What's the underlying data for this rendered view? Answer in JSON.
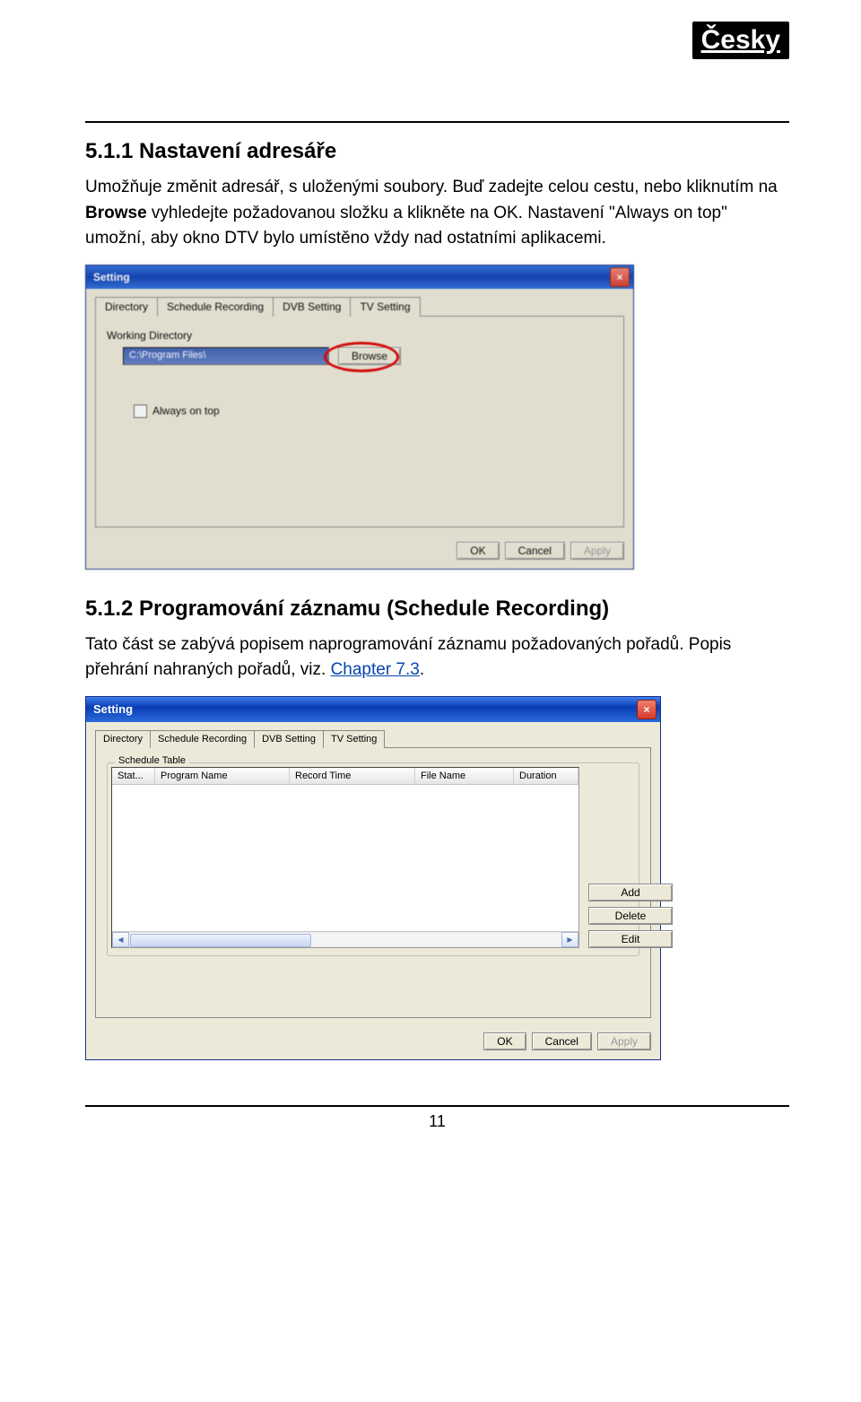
{
  "header": {
    "language_badge": "Česky"
  },
  "sections": {
    "s511": {
      "heading": "5.1.1 Nastavení adresáře",
      "p1_a": "Umožňuje změnit adresář, s uloženými soubory. Buď zadejte celou cestu, nebo kliknutím na ",
      "p1_bold": "Browse",
      "p1_b": " vyhledejte požadovanou složku a klikněte na OK. Nastavení \"Always on top\" umožní, aby okno DTV bylo umístěno vždy nad ostatními aplikacemi."
    },
    "s512": {
      "heading": "5.1.2 Programování záznamu (Schedule Recording)",
      "p1": "Tato část se zabývá popisem naprogramování záznamu požadovaných pořadů. Popis přehrání nahraných pořadů, viz. ",
      "link": "Chapter 7.3",
      "p1_end": "."
    }
  },
  "dialog1": {
    "title": "Setting",
    "tabs": [
      "Directory",
      "Schedule Recording",
      "DVB Setting",
      "TV Setting"
    ],
    "group_label": "Working Directory",
    "path_value": "C:\\Program Files\\",
    "browse": "Browse",
    "always_on_top": "Always on top",
    "ok": "OK",
    "cancel": "Cancel",
    "apply": "Apply"
  },
  "dialog2": {
    "title": "Setting",
    "tabs": [
      "Directory",
      "Schedule Recording",
      "DVB Setting",
      "TV Setting"
    ],
    "group_label": "Schedule Table",
    "columns": [
      "Stat...",
      "Program Name",
      "Record Time",
      "File Name",
      "Duration"
    ],
    "add": "Add",
    "delete": "Delete",
    "edit": "Edit",
    "ok": "OK",
    "cancel": "Cancel",
    "apply": "Apply"
  },
  "footer": {
    "page_number": "11"
  }
}
